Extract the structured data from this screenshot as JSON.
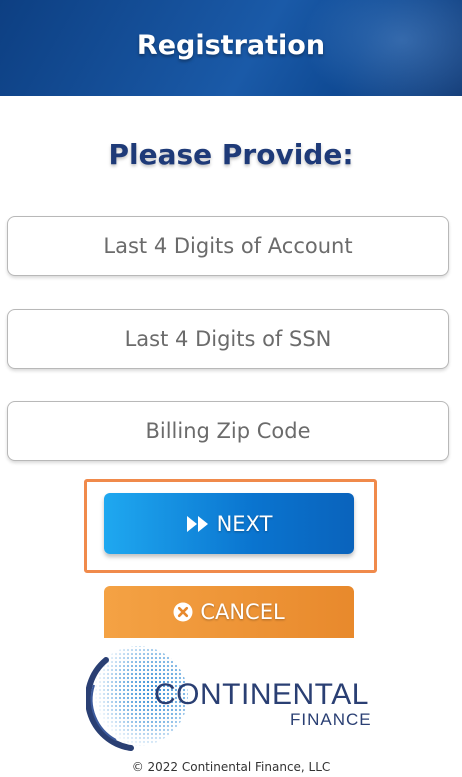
{
  "header": {
    "title": "Registration"
  },
  "form": {
    "prompt": "Please Provide:",
    "fields": [
      {
        "placeholder": "Last 4 Digits of Account"
      },
      {
        "placeholder": "Last 4 Digits of SSN"
      },
      {
        "placeholder": "Billing Zip Code"
      }
    ]
  },
  "buttons": {
    "next_label": "NEXT",
    "next_icon": "fast-forward-icon",
    "cancel_label": "CANCEL",
    "cancel_icon": "circle-x-icon"
  },
  "logo": {
    "name": "CONTINENTAL",
    "sub": "FINANCE"
  },
  "footer": {
    "copyright": "© 2022 Continental Finance, LLC"
  },
  "colors": {
    "header": "#1a5aa8",
    "prompt": "#1e3a78",
    "next": "#0a74cf",
    "cancel": "#e8892c",
    "highlight_outline": "#f08a4b"
  }
}
